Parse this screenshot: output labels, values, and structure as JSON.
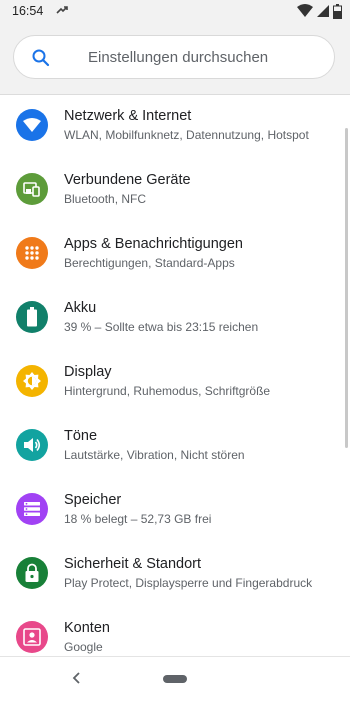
{
  "status_bar": {
    "time": "16:54",
    "left_icon": "data-saver-icon",
    "right_icons": [
      "wifi-icon",
      "signal-icon",
      "battery-icon"
    ]
  },
  "search": {
    "placeholder": "Einstellungen durchsuchen",
    "icon": "search-icon"
  },
  "settings": [
    {
      "title": "Netzwerk & Internet",
      "subtitle": "WLAN, Mobilfunknetz, Datennutzung, Hotspot",
      "icon": "wifi-icon",
      "color": "#1a73e8"
    },
    {
      "title": "Verbundene Geräte",
      "subtitle": "Bluetooth, NFC",
      "icon": "devices-icon",
      "color": "#5d9c3a"
    },
    {
      "title": "Apps & Benachrichtigungen",
      "subtitle": "Berechtigungen, Standard-Apps",
      "icon": "apps-icon",
      "color": "#f07a1a"
    },
    {
      "title": "Akku",
      "subtitle": "39 % – Sollte etwa bis 23:15 reichen",
      "icon": "battery-icon",
      "color": "#11806a"
    },
    {
      "title": "Display",
      "subtitle": "Hintergrund, Ruhemodus, Schriftgröße",
      "icon": "brightness-icon",
      "color": "#f4b400"
    },
    {
      "title": "Töne",
      "subtitle": "Lautstärke, Vibration, Nicht stören",
      "icon": "volume-icon",
      "color": "#12a3a0"
    },
    {
      "title": "Speicher",
      "subtitle": "18 % belegt – 52,73 GB frei",
      "icon": "storage-icon",
      "color": "#a142f4"
    },
    {
      "title": "Sicherheit & Standort",
      "subtitle": "Play Protect, Displaysperre und Fingerabdruck",
      "icon": "lock-icon",
      "color": "#188038"
    },
    {
      "title": "Konten",
      "subtitle": "Google",
      "icon": "account-icon",
      "color": "#e8488a"
    }
  ],
  "nav_bar": {
    "back_icon": "back-icon",
    "home_icon": "home-pill-icon"
  }
}
